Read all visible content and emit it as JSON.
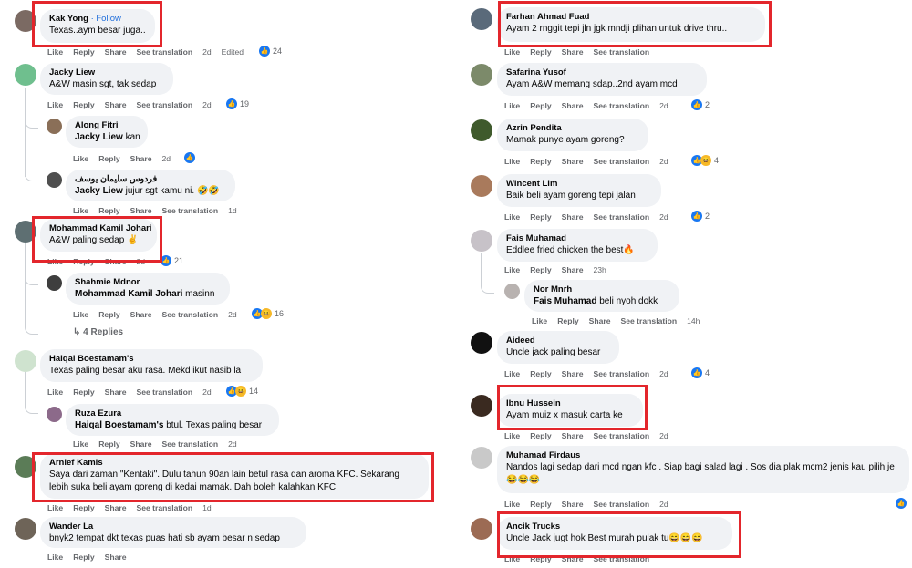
{
  "actions": {
    "like": "Like",
    "reply": "Reply",
    "share": "Share",
    "translate": "See translation"
  },
  "left": {
    "c1": {
      "name": "Kak Yong",
      "follow": "· Follow",
      "text": "Texas..aym besar juga..",
      "time": "2d",
      "edited": "Edited",
      "likes": "24"
    },
    "c2": {
      "name": "Jacky Liew",
      "text": "A&W masin sgt, tak sedap",
      "time": "2d",
      "likes": "19"
    },
    "c3": {
      "name": "Along Fitri",
      "mention": "Jacky Liew",
      "text": " kan",
      "time": "2d"
    },
    "c4": {
      "name": "فردوس سليمان يوسف",
      "mention": "Jacky Liew",
      "text": " jujur sgt kamu ni. 🤣🤣",
      "time": "1d"
    },
    "c5": {
      "name": "Mohammad Kamil Johari",
      "text": "A&W paling sedap ✌",
      "time": "2d",
      "likes": "21"
    },
    "c6": {
      "name": "Shahmie Mdnor",
      "mention": "Mohammad Kamil Johari",
      "text": " masinn",
      "time": "2d",
      "likes": "16"
    },
    "more_replies": "4 Replies",
    "c7": {
      "name": "Haiqal Boestamam's",
      "text": "Texas paling besar aku rasa. Mekd ikut nasib la",
      "time": "2d",
      "likes": "14"
    },
    "c8": {
      "name": "Ruza Ezura",
      "mention": "Haiqal Boestamam's",
      "text": " btul. Texas paling besar",
      "time": "2d"
    },
    "c9": {
      "name": "Arnief Kamis",
      "text": "Saya dari zaman \"Kentaki\". Dulu tahun 90an lain betul rasa dan aroma KFC. Sekarang lebih suka beli ayam goreng di kedai mamak. Dah boleh kalahkan KFC.",
      "time": "1d"
    },
    "c10": {
      "name": "Wander La",
      "text": "bnyk2 tempat dkt texas puas hati sb ayam besar n sedap"
    }
  },
  "right": {
    "c1": {
      "name": "Farhan Ahmad Fuad",
      "text": "Ayam 2 rnggit tepi jln jgk mndji plihan untuk drive thru.."
    },
    "c2": {
      "name": "Safarina Yusof",
      "text": "Ayam A&W memang sdap..2nd ayam mcd",
      "time": "2d",
      "likes": "2"
    },
    "c3": {
      "name": "Azrin Pendita",
      "text": "Mamak punye ayam goreng?",
      "time": "2d",
      "likes": "4"
    },
    "c4": {
      "name": "Wincent Lim",
      "text": "Baik beli ayam goreng tepi jalan",
      "time": "2d",
      "likes": "2"
    },
    "c5": {
      "name": "Fais Muhamad",
      "text": "Eddlee fried chicken the best🔥",
      "time": "23h"
    },
    "c6": {
      "name": "Nor Mnrh",
      "mention": "Fais Muhamad",
      "text": " beli nyoh dokk",
      "time": "14h"
    },
    "c7": {
      "name": "Aideed",
      "text": "Uncle jack paling besar",
      "time": "2d",
      "likes": "4"
    },
    "c8": {
      "name": "Ibnu Hussein",
      "text": "Ayam muiz x masuk carta ke",
      "time": "2d"
    },
    "c9": {
      "name": "Muhamad Firdaus",
      "text": "Nandos lagi sedap dari mcd ngan kfc . Siap bagi salad lagi . Sos dia plak mcm2 jenis kau pilih je😂😂😂 .",
      "time": "2d"
    },
    "c10": {
      "name": "Ancik Trucks",
      "text": "Uncle Jack jugt hok Best murah pulak tu😄😄😄"
    }
  },
  "colors": {
    "highlight": "#e3262c",
    "like": "#1877f2",
    "bubble": "#f0f2f5"
  }
}
